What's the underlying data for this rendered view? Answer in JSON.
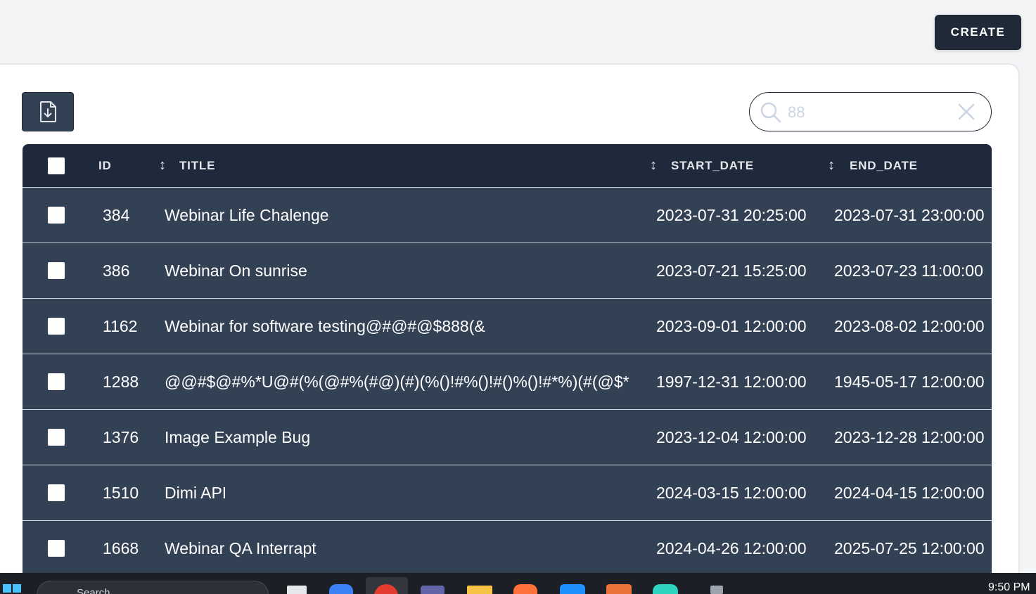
{
  "header": {
    "create_label": "CREATE"
  },
  "toolbar": {
    "export_icon": "file-download-icon",
    "search": {
      "value": "88",
      "search_icon": "search-icon",
      "clear_icon": "close-icon"
    }
  },
  "table": {
    "columns": {
      "id": "ID",
      "title": "TITLE",
      "start_date": "START_DATE",
      "end_date": "END_DATE"
    },
    "sort_glyph": "↕",
    "rows": [
      {
        "id": "384",
        "title": "Webinar Life Chalenge",
        "start_date": "2023-07-31 20:25:00",
        "end_date": "2023-07-31 23:00:00"
      },
      {
        "id": "386",
        "title": "Webinar On sunrise",
        "start_date": "2023-07-21 15:25:00",
        "end_date": "2023-07-23 11:00:00"
      },
      {
        "id": "1162",
        "title": "Webinar for software testing@#@#@$888(&",
        "start_date": "2023-09-01 12:00:00",
        "end_date": "2023-08-02 12:00:00"
      },
      {
        "id": "1288",
        "title": "@@#$@#%*U@#(%(@#%(#@)(#)(%()!#%()!#()%()!#*%)(#(@$*",
        "start_date": "1997-12-31 12:00:00",
        "end_date": "1945-05-17 12:00:00"
      },
      {
        "id": "1376",
        "title": "Image Example Bug",
        "start_date": "2023-12-04 12:00:00",
        "end_date": "2023-12-28 12:00:00"
      },
      {
        "id": "1510",
        "title": "Dimi API",
        "start_date": "2024-03-15 12:00:00",
        "end_date": "2024-04-15 12:00:00"
      },
      {
        "id": "1668",
        "title": "Webinar QA Interrapt",
        "start_date": "2024-04-26 12:00:00",
        "end_date": "2025-07-25 12:00:00"
      }
    ]
  },
  "taskbar": {
    "search_label": "Search",
    "time": "9:50 PM"
  },
  "colors": {
    "header_bg": "#1e293b",
    "row_bg": "#334155",
    "button_bg": "#1f2937",
    "page_bg": "#f3f4f6"
  }
}
